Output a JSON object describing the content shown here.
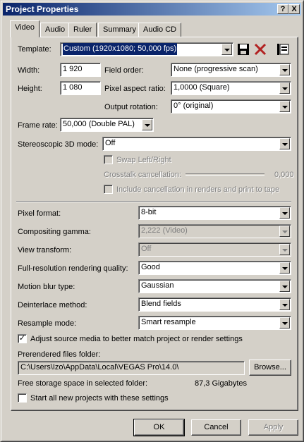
{
  "window": {
    "title": "Project Properties",
    "help_glyph": "?",
    "close_glyph": "X"
  },
  "tabs": [
    "Video",
    "Audio",
    "Ruler",
    "Summary",
    "Audio CD"
  ],
  "template": {
    "label": "Template:",
    "value": "Custom (1920x1080; 50,000 fps)"
  },
  "width": {
    "label": "Width:",
    "value": "1 920"
  },
  "height": {
    "label": "Height:",
    "value": "1 080"
  },
  "field_order": {
    "label": "Field order:",
    "value": "None (progressive scan)"
  },
  "pixel_aspect": {
    "label": "Pixel aspect ratio:",
    "value": "1,0000 (Square)"
  },
  "output_rotation": {
    "label": "Output rotation:",
    "value": "0° (original)"
  },
  "frame_rate": {
    "label": "Frame rate:",
    "value": "50,000 (Double PAL)"
  },
  "stereo": {
    "label": "Stereoscopic 3D mode:",
    "value": "Off",
    "swap_label": "Swap Left/Right",
    "crosstalk_label": "Crosstalk cancellation:",
    "crosstalk_value": "0,000",
    "include_label": "Include cancellation in renders and print to tape"
  },
  "pixel_format": {
    "label": "Pixel format:",
    "value": "8-bit"
  },
  "compositing_gamma": {
    "label": "Compositing gamma:",
    "value": "2,222 (Video)"
  },
  "view_transform": {
    "label": "View transform:",
    "value": "Off"
  },
  "render_quality": {
    "label": "Full-resolution rendering quality:",
    "value": "Good"
  },
  "motion_blur": {
    "label": "Motion blur type:",
    "value": "Gaussian"
  },
  "deinterlace": {
    "label": "Deinterlace method:",
    "value": "Blend fields"
  },
  "resample": {
    "label": "Resample mode:",
    "value": "Smart resample"
  },
  "adjust_media": {
    "label": "Adjust source media to better match project or render settings",
    "checked": true,
    "mark": "✓"
  },
  "prerendered": {
    "label": "Prerendered files folder:",
    "path": "C:\\Users\\Izo\\AppData\\Local\\VEGAS Pro\\14.0\\",
    "browse_label": "Browse..."
  },
  "storage": {
    "label": "Free storage space in selected folder:",
    "value": "87,3 Gigabytes"
  },
  "start_all": {
    "label": "Start all new projects with these settings",
    "checked": false
  },
  "buttons": {
    "ok": "OK",
    "cancel": "Cancel",
    "apply": "Apply"
  },
  "colors": {
    "title_start": "#0a246a",
    "title_end": "#a6caf0",
    "face": "#d4d0c8",
    "delete_red": "#b22222"
  }
}
